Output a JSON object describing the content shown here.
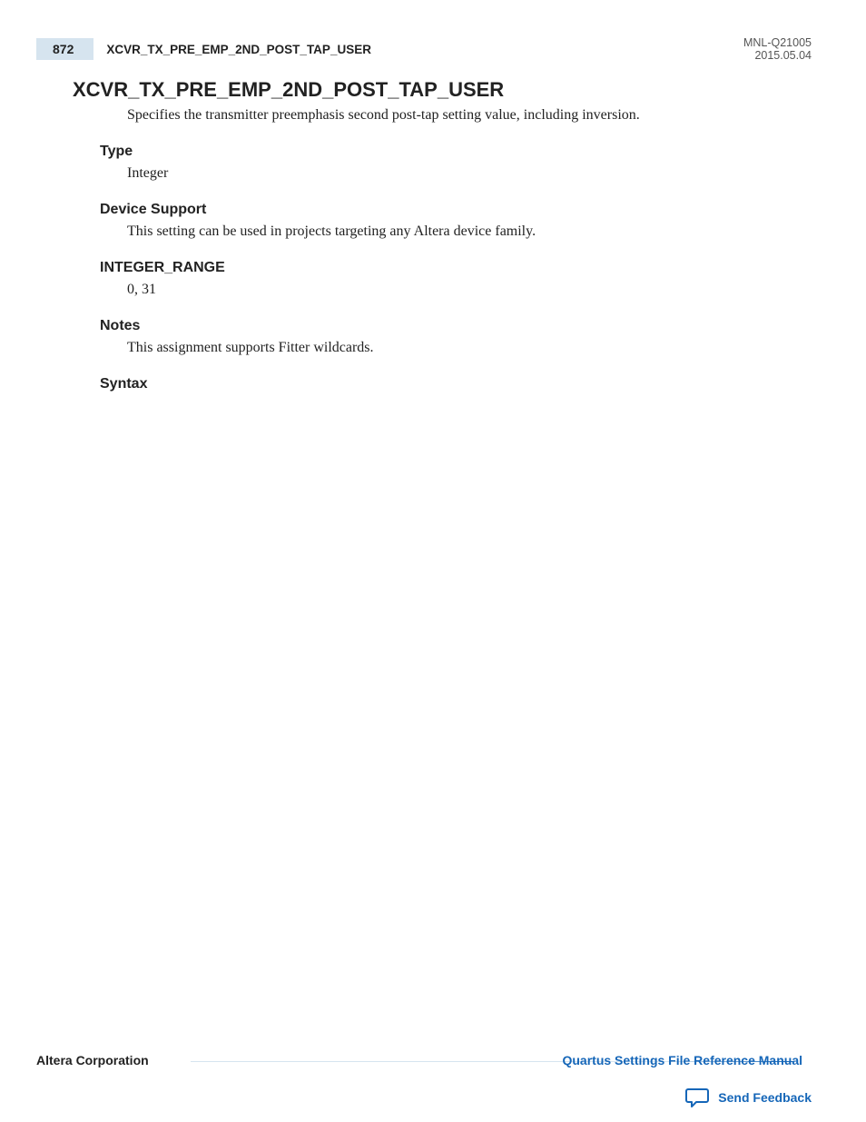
{
  "header": {
    "page_number": "872",
    "running_title": "XCVR_TX_PRE_EMP_2ND_POST_TAP_USER",
    "doc_id": "MNL-Q21005",
    "doc_date": "2015.05.04"
  },
  "title": "XCVR_TX_PRE_EMP_2ND_POST_TAP_USER",
  "intro": "Specifies the transmitter preemphasis second post-tap setting value, including inversion.",
  "sections": {
    "type": {
      "heading": "Type",
      "body": "Integer"
    },
    "device_support": {
      "heading": "Device Support",
      "body": "This setting can be used in projects targeting any Altera device family."
    },
    "integer_range": {
      "heading": "INTEGER_RANGE",
      "body": "0, 31"
    },
    "notes": {
      "heading": "Notes",
      "body": "This assignment supports Fitter wildcards."
    },
    "syntax": {
      "heading": "Syntax"
    }
  },
  "footer": {
    "corp": "Altera Corporation",
    "manual_link": "Quartus Settings File Reference Manual",
    "send_feedback": "Send Feedback"
  }
}
